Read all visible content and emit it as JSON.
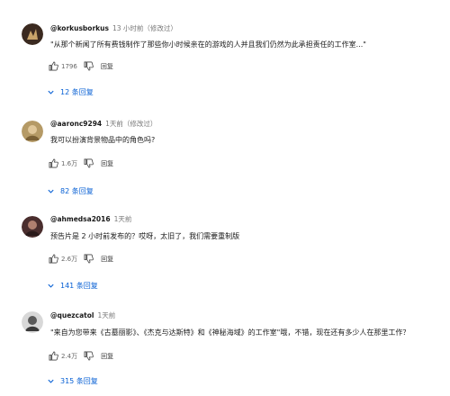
{
  "comments": [
    {
      "author": "@korkusborkus",
      "time": "13 小时前（修改过）",
      "text": "\"从那个新闻了所有费钱制作了那些你小时候亲在的游戏的人并且我们仍然为此承担责任的工作室...\"",
      "likes": "1796",
      "reply_label": "回复",
      "replies_label": "12 条回复",
      "avatar_color": "#3b2a20"
    },
    {
      "author": "@aaronc9294",
      "time": "1天前（修改过）",
      "text": "我可以扮演背景物品中的角色吗?",
      "likes": "1.6万",
      "reply_label": "回复",
      "replies_label": "82 条回复",
      "avatar_color": "#a89060"
    },
    {
      "author": "@ahmedsa2016",
      "time": "1天前",
      "text": "预告片是 2 小时前发布的？哎呀，太旧了，我们需要重制版",
      "likes": "2.6万",
      "reply_label": "回复",
      "replies_label": "141 条回复",
      "avatar_color": "#4a2e2e"
    },
    {
      "author": "@quezcatol",
      "time": "1天前",
      "text": "\"来自为您带来《古墓丽影》、《杰克与达斯特》和《神秘海域》的工作室\"哦，不错，现在还有多少人在那里工作？",
      "likes": "2.4万",
      "reply_label": "回复",
      "replies_label": "315 条回复",
      "avatar_color": "#6a6a6a"
    }
  ]
}
